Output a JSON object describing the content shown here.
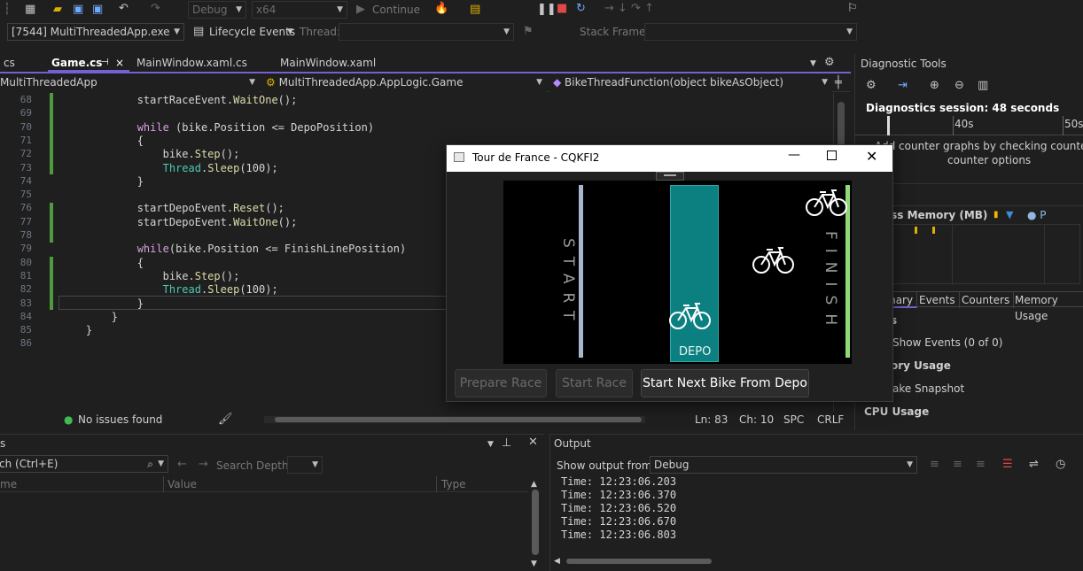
{
  "toolbar": {
    "config": "Debug",
    "platform": "x64",
    "continue": "Continue"
  },
  "toolbar2": {
    "process": "[7544] MultiThreadedApp.exe",
    "lifecycle": "Lifecycle Events",
    "thread_label": "Thread:",
    "stack_label": "Stack Frame:"
  },
  "tabs": [
    "cs",
    "Game.cs",
    "MainWindow.xaml.cs",
    "MainWindow.xaml"
  ],
  "nav": {
    "project": "MultiThreadedApp",
    "class": "MultiThreadedApp.AppLogic.Game",
    "member": "BikeThreadFunction(object bikeAsObject)"
  },
  "code_lines": [
    {
      "n": "68",
      "t": "            startRaceEvent.WaitOne();"
    },
    {
      "n": "69",
      "t": ""
    },
    {
      "n": "70",
      "t": "            while (bike.Position <= DepoPosition)"
    },
    {
      "n": "71",
      "t": "            {"
    },
    {
      "n": "72",
      "t": "                bike.Step();"
    },
    {
      "n": "73",
      "t": "                Thread.Sleep(100);"
    },
    {
      "n": "74",
      "t": "            }"
    },
    {
      "n": "75",
      "t": ""
    },
    {
      "n": "76",
      "t": "            startDepoEvent.Reset();"
    },
    {
      "n": "77",
      "t": "            startDepoEvent.WaitOne();"
    },
    {
      "n": "78",
      "t": ""
    },
    {
      "n": "79",
      "t": "            while(bike.Position <= FinishLinePosition)"
    },
    {
      "n": "80",
      "t": "            {"
    },
    {
      "n": "81",
      "t": "                bike.Step();"
    },
    {
      "n": "82",
      "t": "                Thread.Sleep(100);"
    },
    {
      "n": "83",
      "t": "            }"
    },
    {
      "n": "84",
      "t": "        }"
    },
    {
      "n": "85",
      "t": "    }"
    },
    {
      "n": "86",
      "t": ""
    }
  ],
  "status": {
    "issues": "No issues found",
    "ln": "Ln: 83",
    "ch": "Ch: 10",
    "spc": "SPC",
    "crlf": "CRLF"
  },
  "app_window": {
    "title": "Tour de France - CQKFI2",
    "start_label": "START",
    "finish_label": "FINISH",
    "depo_label": "DEPO",
    "buttons": [
      "Prepare Race",
      "Start Race",
      "Start Next Bike From Depo"
    ]
  },
  "diag": {
    "title": "Diagnostic Tools",
    "session": "Diagnostics session: 48 seconds",
    "tick1": "40s",
    "tick2": "50s",
    "hint1": "Add counter graphs by checking counters fro",
    "hint2": "counter options",
    "events_hdr": "ts",
    "memory_hdr": "ess Memory (MB)",
    "tabs": [
      "mary",
      "Events",
      "Counters",
      "Memory Usage"
    ],
    "s1": "s",
    "show_events": "Show Events (0 of 0)",
    "mem_usage": "ory Usage",
    "snapshot": "ake Snapshot",
    "cpu": "CPU Usage"
  },
  "locals": {
    "search": "ch (Ctrl+E)",
    "depth": "Search Depth:",
    "col_name": "me",
    "col_value": "Value",
    "col_type": "Type",
    "title": "s"
  },
  "output": {
    "title": "Output",
    "show_from": "Show output from:",
    "source": "Debug",
    "lines": [
      "Time: 12:23:06.203",
      "Time: 12:23:06.370",
      "Time: 12:23:06.520",
      "Time: 12:23:06.670",
      "Time: 12:23:06.803"
    ]
  },
  "colors": {
    "accent": "#7460d0",
    "depo": "#0c8080",
    "finish": "#8fd97a",
    "start": "#a9b7cc"
  }
}
